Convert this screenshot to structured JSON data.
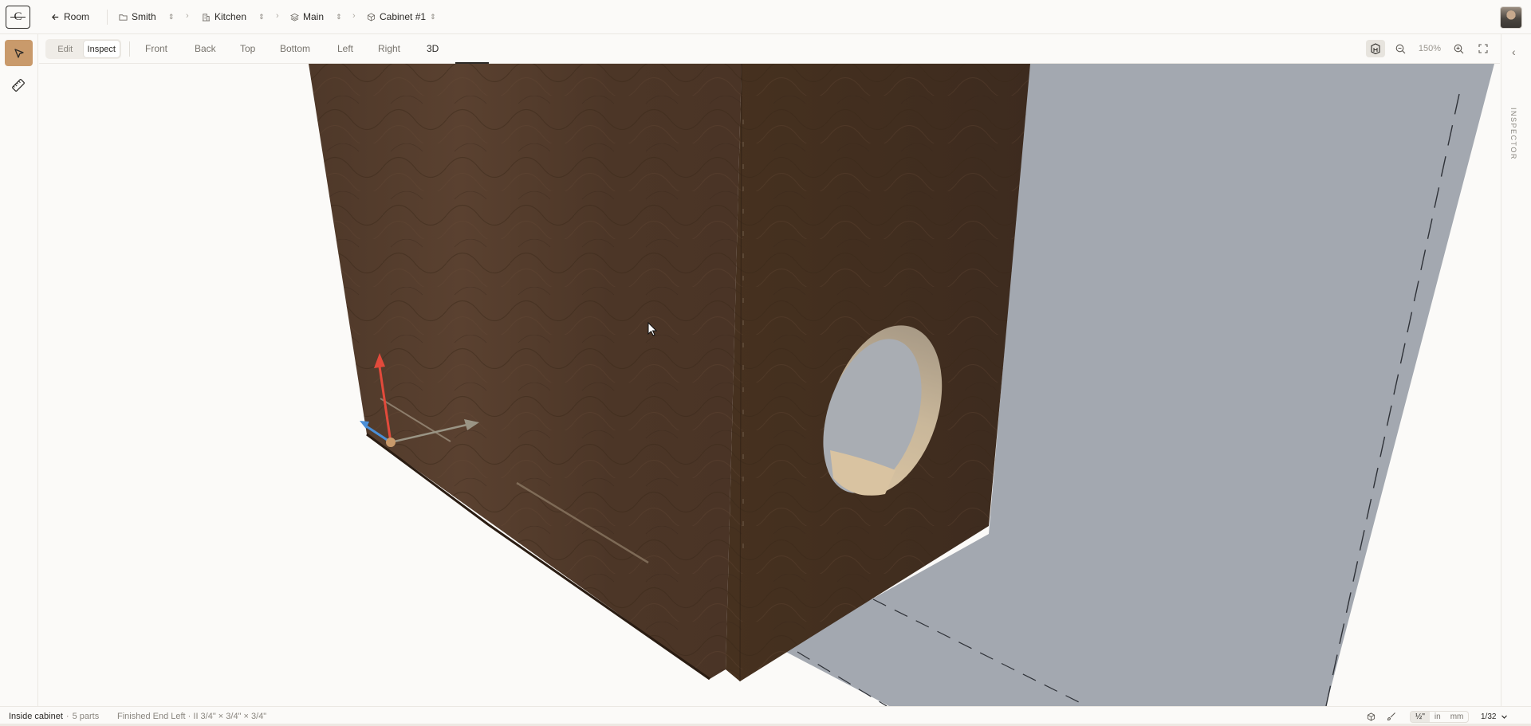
{
  "header": {
    "logo_text": "C",
    "back_label": "Room",
    "breadcrumbs": [
      {
        "label": "Smith",
        "icon": "folder-icon"
      },
      {
        "label": "Kitchen",
        "icon": "building-icon"
      },
      {
        "label": "Main",
        "icon": "layers-icon"
      },
      {
        "label": "Cabinet #1",
        "icon": "cube-icon"
      }
    ]
  },
  "toolbar": {
    "modes": [
      {
        "label": "Edit",
        "active": false
      },
      {
        "label": "Inspect",
        "active": true
      }
    ],
    "views": [
      "Front",
      "Back",
      "Top",
      "Bottom",
      "Left",
      "Right",
      "3D"
    ],
    "active_view": "3D",
    "zoom": "150%"
  },
  "inspector": {
    "label": "INSPECTOR"
  },
  "status": {
    "context": "Inside cabinet",
    "separator": "·",
    "parts": "5 parts",
    "selection": "Finished End Left · II 3/4\" × 3/4\" × 3/4\"",
    "units": [
      "½\"",
      "in",
      "mm"
    ],
    "active_unit": "½\"",
    "precision": "1/32"
  },
  "colors": {
    "accent": "#c99a6b",
    "wood": "#4a3426",
    "floor": "#a3a8b0",
    "axis_x": "#9a9585",
    "axis_y": "#e24a3b",
    "axis_z": "#4a8fd8"
  }
}
